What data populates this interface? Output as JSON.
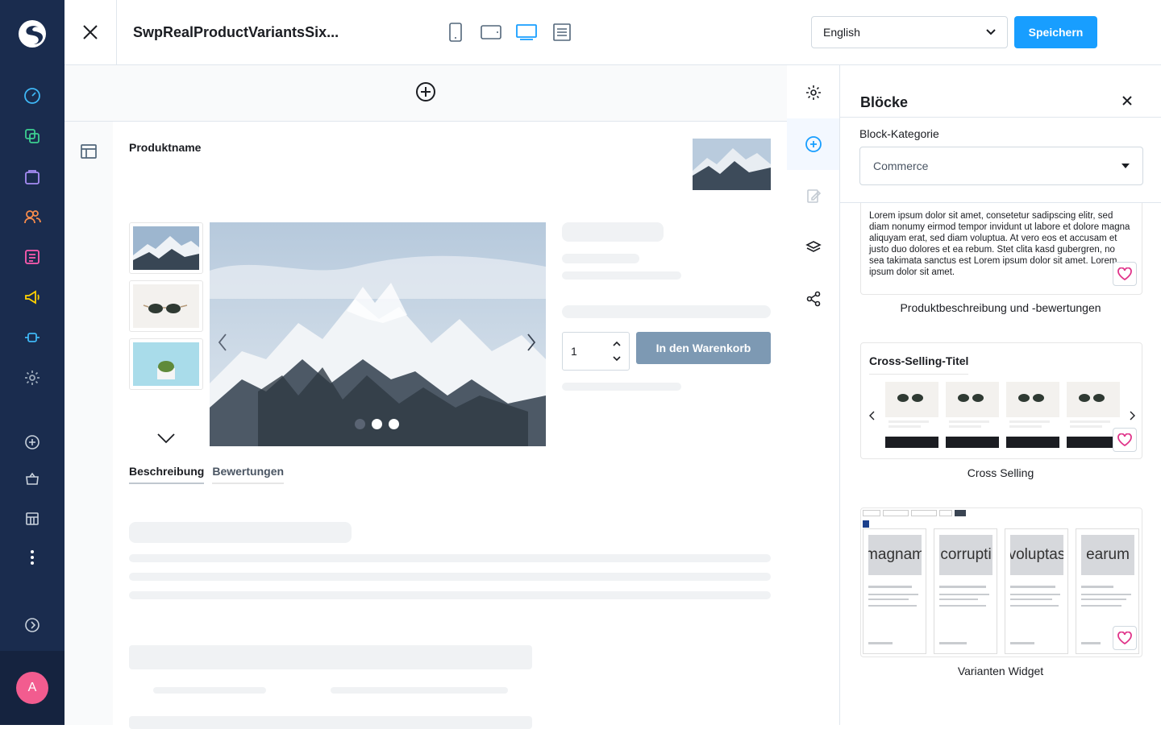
{
  "nav": {
    "brand_icon": "shopware-logo",
    "items": [
      "dashboard-icon",
      "catalogue-icon",
      "orders-icon",
      "customers-icon",
      "content-icon",
      "marketing-icon",
      "extensions-icon",
      "settings-icon",
      "add-icon",
      "store-icon",
      "sales-channel-icon",
      "more-icon",
      "expand-icon"
    ],
    "avatar_initial": "A",
    "colors": {
      "nav_bg": "#1a2c4e",
      "avatar_bg": "#f25c8f"
    }
  },
  "header": {
    "title": "SwpRealProductVariantsSix...",
    "devices": [
      "mobile-icon",
      "tablet-icon",
      "desktop-icon",
      "form-icon"
    ],
    "active_device": "desktop-icon",
    "language": "English",
    "save_label": "Speichern",
    "colors": {
      "primary": "#189eff"
    }
  },
  "canvas": {
    "product_name_label": "Produktname",
    "quantity_value": "1",
    "add_to_cart_label": "In den Warenkorb",
    "tabs": [
      "Beschreibung",
      "Bewertungen"
    ],
    "gallery_dots": 3
  },
  "panel": {
    "title": "Blöcke",
    "category_label": "Block-Kategorie",
    "category_value": "Commerce",
    "blocks": [
      {
        "label": "Produktbeschreibung und -bewertungen",
        "preview_text": "Lorem ipsum dolor sit amet, consetetur sadipscing elitr, sed diam nonumy eirmod tempor invidunt ut labore et dolore magna aliquyam erat, sed diam voluptua. At vero eos et accusam et justo duo dolores et ea rebum. Stet clita kasd gubergren, no sea takimata sanctus est Lorem ipsum dolor sit amet. Lorem ipsum dolor sit amet."
      },
      {
        "label": "Cross Selling",
        "preview_title": "Cross-Selling-Titel"
      },
      {
        "label": "Varianten Widget",
        "preview_words": [
          "magnam",
          "corrupti",
          "voluptas",
          "earum"
        ]
      }
    ]
  }
}
